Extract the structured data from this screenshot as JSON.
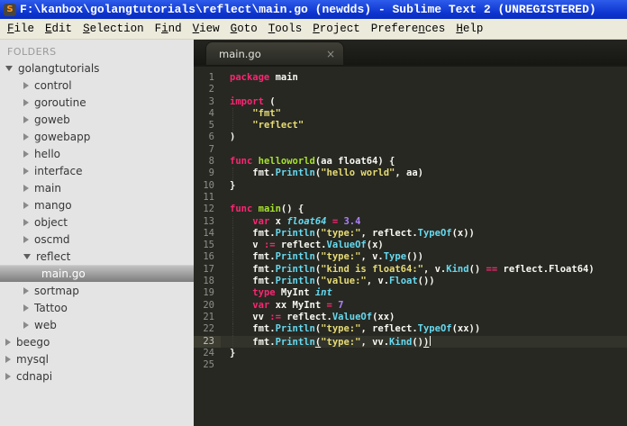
{
  "window": {
    "title": "F:\\kanbox\\golangtutorials\\reflect\\main.go (newdds) - Sublime Text 2 (UNREGISTERED)",
    "app_icon_glyph": "S"
  },
  "menu": {
    "items": [
      {
        "label": "File",
        "mnemonic_index": 0
      },
      {
        "label": "Edit",
        "mnemonic_index": 0
      },
      {
        "label": "Selection",
        "mnemonic_index": 0
      },
      {
        "label": "Find",
        "mnemonic_index": 1
      },
      {
        "label": "View",
        "mnemonic_index": 0
      },
      {
        "label": "Goto",
        "mnemonic_index": 0
      },
      {
        "label": "Tools",
        "mnemonic_index": 0
      },
      {
        "label": "Project",
        "mnemonic_index": 0
      },
      {
        "label": "Preferences",
        "mnemonic_index": 7
      },
      {
        "label": "Help",
        "mnemonic_index": 0
      }
    ]
  },
  "sidebar": {
    "header": "FOLDERS",
    "items": [
      {
        "label": "golangtutorials",
        "depth": 0,
        "type": "folder",
        "state": "expanded",
        "selected": false
      },
      {
        "label": "control",
        "depth": 1,
        "type": "folder",
        "state": "collapsed",
        "selected": false
      },
      {
        "label": "goroutine",
        "depth": 1,
        "type": "folder",
        "state": "collapsed",
        "selected": false
      },
      {
        "label": "goweb",
        "depth": 1,
        "type": "folder",
        "state": "collapsed",
        "selected": false
      },
      {
        "label": "gowebapp",
        "depth": 1,
        "type": "folder",
        "state": "collapsed",
        "selected": false
      },
      {
        "label": "hello",
        "depth": 1,
        "type": "folder",
        "state": "collapsed",
        "selected": false
      },
      {
        "label": "interface",
        "depth": 1,
        "type": "folder",
        "state": "collapsed",
        "selected": false
      },
      {
        "label": "main",
        "depth": 1,
        "type": "folder",
        "state": "collapsed",
        "selected": false
      },
      {
        "label": "mango",
        "depth": 1,
        "type": "folder",
        "state": "collapsed",
        "selected": false
      },
      {
        "label": "object",
        "depth": 1,
        "type": "folder",
        "state": "collapsed",
        "selected": false
      },
      {
        "label": "oscmd",
        "depth": 1,
        "type": "folder",
        "state": "collapsed",
        "selected": false
      },
      {
        "label": "reflect",
        "depth": 1,
        "type": "folder",
        "state": "expanded",
        "selected": false
      },
      {
        "label": "main.go",
        "depth": 2,
        "type": "file",
        "state": "none",
        "selected": true
      },
      {
        "label": "sortmap",
        "depth": 1,
        "type": "folder",
        "state": "collapsed",
        "selected": false
      },
      {
        "label": "Tattoo",
        "depth": 1,
        "type": "folder",
        "state": "collapsed",
        "selected": false
      },
      {
        "label": "web",
        "depth": 1,
        "type": "folder",
        "state": "collapsed",
        "selected": false
      },
      {
        "label": "beego",
        "depth": 0,
        "type": "folder",
        "state": "collapsed",
        "selected": false
      },
      {
        "label": "mysql",
        "depth": 0,
        "type": "folder",
        "state": "collapsed",
        "selected": false
      },
      {
        "label": "cdnapi",
        "depth": 0,
        "type": "folder",
        "state": "collapsed",
        "selected": false
      }
    ]
  },
  "tabbar": {
    "tabs": [
      {
        "label": "main.go",
        "active": true,
        "close_glyph": "×"
      }
    ]
  },
  "editor": {
    "current_line": 23,
    "lines": [
      {
        "num": 1,
        "tokens": [
          [
            "k",
            "package"
          ],
          [
            "p",
            " main"
          ]
        ]
      },
      {
        "num": 2,
        "tokens": []
      },
      {
        "num": 3,
        "tokens": [
          [
            "k",
            "import"
          ],
          [
            "p",
            " ("
          ]
        ]
      },
      {
        "num": 4,
        "indent": true,
        "tokens": [
          [
            "p",
            "    "
          ],
          [
            "s",
            "\"fmt\""
          ]
        ]
      },
      {
        "num": 5,
        "indent": true,
        "tokens": [
          [
            "p",
            "    "
          ],
          [
            "s",
            "\"reflect\""
          ]
        ]
      },
      {
        "num": 6,
        "tokens": [
          [
            "p",
            ")"
          ]
        ]
      },
      {
        "num": 7,
        "tokens": []
      },
      {
        "num": 8,
        "tokens": [
          [
            "k",
            "func"
          ],
          [
            "p",
            " "
          ],
          [
            "f",
            "helloworld"
          ],
          [
            "p",
            "(aa float64) {"
          ]
        ]
      },
      {
        "num": 9,
        "indent": true,
        "tokens": [
          [
            "p",
            "    fmt."
          ],
          [
            "c",
            "Println"
          ],
          [
            "p",
            "("
          ],
          [
            "s",
            "\"hello world\""
          ],
          [
            "p",
            ", aa)"
          ]
        ]
      },
      {
        "num": 10,
        "tokens": [
          [
            "p",
            "}"
          ]
        ]
      },
      {
        "num": 11,
        "tokens": []
      },
      {
        "num": 12,
        "tokens": [
          [
            "k",
            "func"
          ],
          [
            "p",
            " "
          ],
          [
            "f",
            "main"
          ],
          [
            "p",
            "() {"
          ]
        ]
      },
      {
        "num": 13,
        "indent": true,
        "tokens": [
          [
            "p",
            "    "
          ],
          [
            "k",
            "var"
          ],
          [
            "p",
            " x "
          ],
          [
            "t",
            "float64"
          ],
          [
            "p",
            " "
          ],
          [
            "k",
            "="
          ],
          [
            "p",
            " "
          ],
          [
            "n",
            "3.4"
          ]
        ]
      },
      {
        "num": 14,
        "indent": true,
        "tokens": [
          [
            "p",
            "    fmt."
          ],
          [
            "c",
            "Println"
          ],
          [
            "p",
            "("
          ],
          [
            "s",
            "\"type:\""
          ],
          [
            "p",
            ", reflect."
          ],
          [
            "c",
            "TypeOf"
          ],
          [
            "p",
            "(x))"
          ]
        ]
      },
      {
        "num": 15,
        "indent": true,
        "tokens": [
          [
            "p",
            "    v "
          ],
          [
            "k",
            ":="
          ],
          [
            "p",
            " reflect."
          ],
          [
            "c",
            "ValueOf"
          ],
          [
            "p",
            "(x)"
          ]
        ]
      },
      {
        "num": 16,
        "indent": true,
        "tokens": [
          [
            "p",
            "    fmt."
          ],
          [
            "c",
            "Println"
          ],
          [
            "p",
            "("
          ],
          [
            "s",
            "\"type:\""
          ],
          [
            "p",
            ", v."
          ],
          [
            "c",
            "Type"
          ],
          [
            "p",
            "())"
          ]
        ]
      },
      {
        "num": 17,
        "indent": true,
        "tokens": [
          [
            "p",
            "    fmt."
          ],
          [
            "c",
            "Println"
          ],
          [
            "p",
            "("
          ],
          [
            "s",
            "\"kind is float64:\""
          ],
          [
            "p",
            ", v."
          ],
          [
            "c",
            "Kind"
          ],
          [
            "p",
            "() "
          ],
          [
            "k",
            "=="
          ],
          [
            "p",
            " reflect.Float64)"
          ]
        ]
      },
      {
        "num": 18,
        "indent": true,
        "tokens": [
          [
            "p",
            "    fmt."
          ],
          [
            "c",
            "Println"
          ],
          [
            "p",
            "("
          ],
          [
            "s",
            "\"value:\""
          ],
          [
            "p",
            ", v."
          ],
          [
            "c",
            "Float"
          ],
          [
            "p",
            "())"
          ]
        ]
      },
      {
        "num": 19,
        "indent": true,
        "tokens": [
          [
            "p",
            "    "
          ],
          [
            "k",
            "type"
          ],
          [
            "p",
            " MyInt "
          ],
          [
            "t",
            "int"
          ]
        ]
      },
      {
        "num": 20,
        "indent": true,
        "tokens": [
          [
            "p",
            "    "
          ],
          [
            "k",
            "var"
          ],
          [
            "p",
            " xx MyInt "
          ],
          [
            "k",
            "="
          ],
          [
            "p",
            " "
          ],
          [
            "n",
            "7"
          ]
        ]
      },
      {
        "num": 21,
        "indent": true,
        "tokens": [
          [
            "p",
            "    vv "
          ],
          [
            "k",
            ":="
          ],
          [
            "p",
            " reflect."
          ],
          [
            "c",
            "ValueOf"
          ],
          [
            "p",
            "(xx)"
          ]
        ]
      },
      {
        "num": 22,
        "indent": true,
        "tokens": [
          [
            "p",
            "    fmt."
          ],
          [
            "c",
            "Println"
          ],
          [
            "p",
            "("
          ],
          [
            "s",
            "\"type:\""
          ],
          [
            "p",
            ", reflect."
          ],
          [
            "c",
            "TypeOf"
          ],
          [
            "p",
            "(xx))"
          ]
        ]
      },
      {
        "num": 23,
        "indent": true,
        "cursor": true,
        "tokens": [
          [
            "p",
            "    fmt."
          ],
          [
            "c",
            "Println"
          ],
          [
            "pu",
            "("
          ],
          [
            "s",
            "\"type:\""
          ],
          [
            "p",
            ", vv."
          ],
          [
            "c",
            "Kind"
          ],
          [
            "p",
            "()"
          ],
          [
            "pu",
            ")"
          ]
        ]
      },
      {
        "num": 24,
        "tokens": [
          [
            "p",
            "}"
          ]
        ]
      },
      {
        "num": 25,
        "tokens": []
      }
    ]
  },
  "colors": {
    "titlebar_blue": "#0d34d0",
    "menubar_bg": "#eceadb",
    "sidebar_bg": "#e4e4e4",
    "editor_bg": "#272822",
    "keyword": "#f92672",
    "function_def": "#a6e22e",
    "type": "#66d9ef",
    "call": "#66d9ef",
    "string": "#e6db74",
    "number": "#ae81ff",
    "plain": "#f8f8f2",
    "line_number": "#8f908a",
    "current_line": "#3e3d32",
    "selection_gradient_top": "#c2c2c2",
    "selection_gradient_bottom": "#7d7d7d"
  }
}
